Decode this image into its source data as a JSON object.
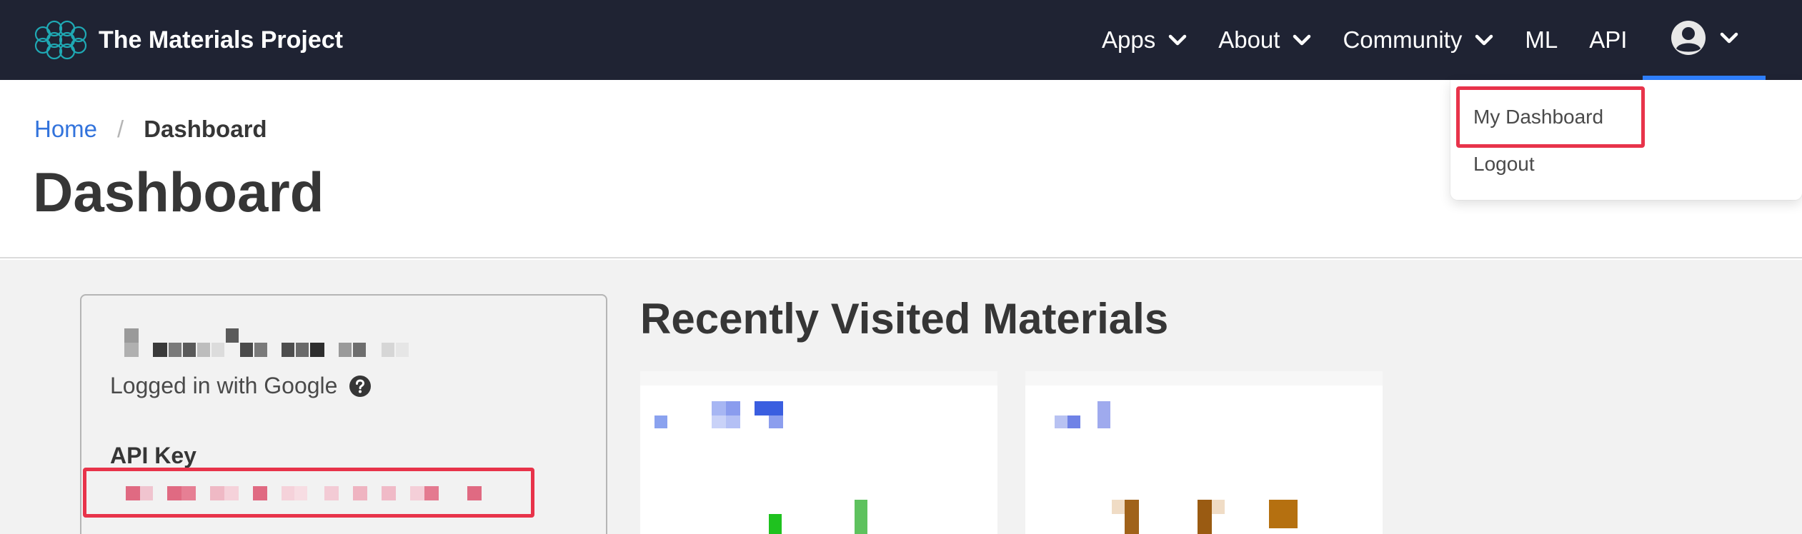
{
  "navbar": {
    "brand_title": "The Materials Project",
    "items": [
      {
        "label": "Apps",
        "has_dropdown": true
      },
      {
        "label": "About",
        "has_dropdown": true
      },
      {
        "label": "Community",
        "has_dropdown": true
      },
      {
        "label": "ML",
        "has_dropdown": false
      },
      {
        "label": "API",
        "has_dropdown": false
      }
    ],
    "user_icon": "user-circle-icon",
    "colors": {
      "background": "#1f2333",
      "active_underline": "#2f80ff"
    }
  },
  "breadcrumb": {
    "home": "Home",
    "separator": "/",
    "current": "Dashboard"
  },
  "page": {
    "title": "Dashboard"
  },
  "user_menu": {
    "items": [
      {
        "label": "My Dashboard",
        "highlighted": true
      },
      {
        "label": "Logout",
        "highlighted": false
      }
    ]
  },
  "profile": {
    "login_method": "Logged in with Google",
    "help_icon": "question-circle-icon",
    "api_key_label": "API Key"
  },
  "recent": {
    "title": "Recently Visited Materials"
  },
  "highlight_color": "#e8334a"
}
